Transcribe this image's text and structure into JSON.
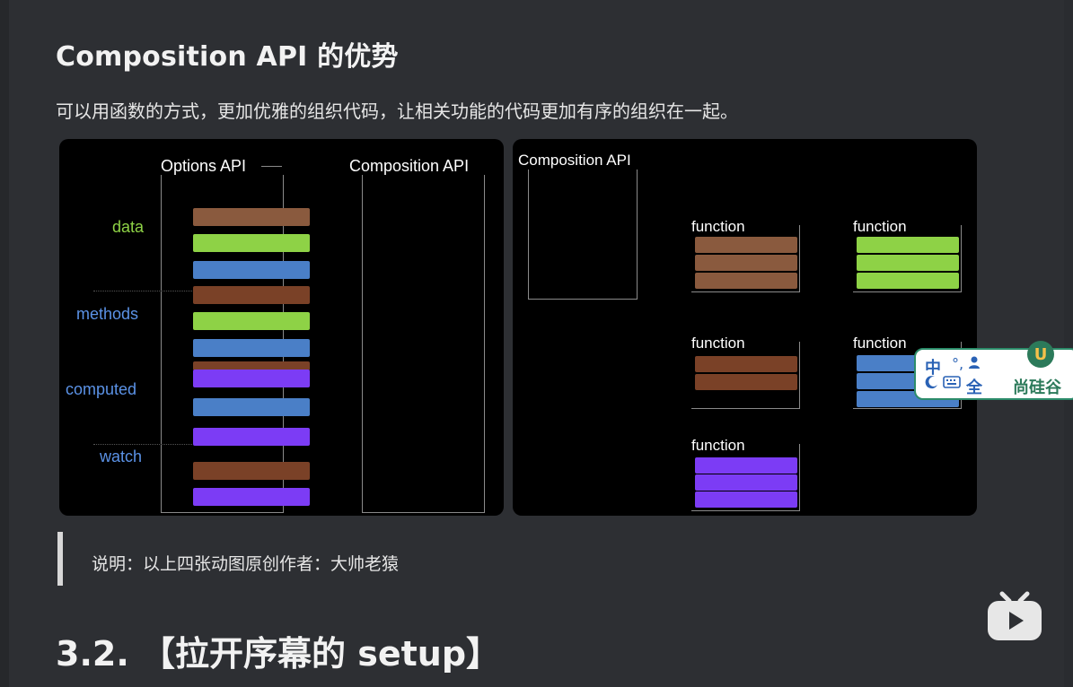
{
  "page": {
    "heading": "Composition API 的优势",
    "lead": "可以用函数的方式，更加优雅的组织代码，让相关功能的代码更加有序的组织在一起。",
    "note": "说明：以上四张动图原创作者：大帅老猿",
    "section_title": "3.2. 【拉开序幕的 setup】"
  },
  "diagram_left": {
    "title_options": "Options API",
    "title_composition": "Composition API",
    "categories": [
      {
        "label": "data",
        "color": "#8ed246"
      },
      {
        "label": "methods",
        "color": "#4a7fc7"
      },
      {
        "label": "computed",
        "color": "#4a7fc7"
      },
      {
        "label": "watch",
        "color": "#4a7fc7"
      }
    ]
  },
  "diagram_right": {
    "title_composition": "Composition API",
    "function_label": "function"
  },
  "overlays": {
    "ime": {
      "lang": "中",
      "punct": "°,",
      "user_icon": "user-icon",
      "moon_icon": "moon-icon",
      "keyboard_icon": "keyboard-icon",
      "full_width": "全",
      "brand": "尚硅谷",
      "brand_logo_letter": "U"
    },
    "player": {
      "icon": "tv-play-icon"
    }
  },
  "colors": {
    "brown": "#8a5a3e",
    "green": "#8ed246",
    "blue": "#4a7fc7",
    "purple": "#7c3cf5"
  }
}
